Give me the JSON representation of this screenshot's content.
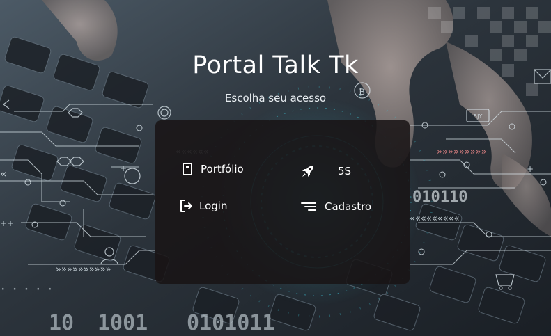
{
  "header": {
    "title": "Portal Talk Tk",
    "subtitle": "Escolha seu acesso"
  },
  "menu": {
    "items": [
      {
        "label": "Portfólio",
        "icon": "book-icon"
      },
      {
        "label": "Login",
        "icon": "login-icon"
      },
      {
        "label": "5S",
        "icon": "rocket-icon"
      },
      {
        "label": "Cadastro",
        "icon": "sort-lines-icon"
      }
    ]
  },
  "background": {
    "digits": [
      "10",
      "1001",
      "0101011",
      "010110"
    ],
    "tag": "5JY",
    "arrows": "»»»»»»»»"
  },
  "colors": {
    "panel": "#181415",
    "accent": "#3fc1d3",
    "text": "#ffffff"
  }
}
